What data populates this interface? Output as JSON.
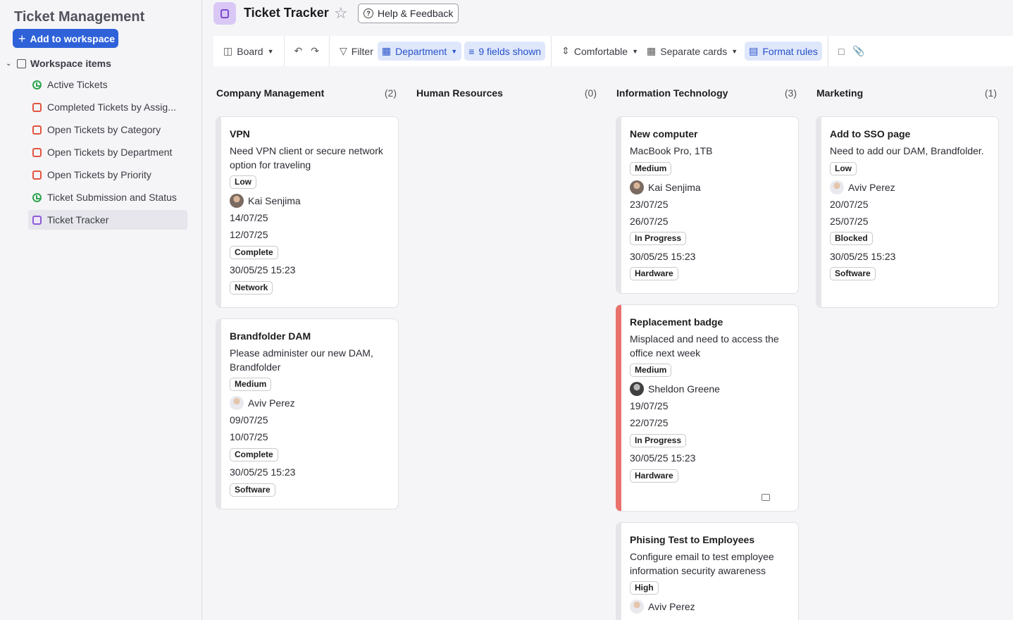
{
  "sidebar": {
    "title": "Ticket Management",
    "add_button": "Add to workspace",
    "section": "Workspace items",
    "items": [
      {
        "label": "Active Tickets",
        "icon": "dashboard-icon"
      },
      {
        "label": "Completed Tickets by Assig...",
        "icon": "report-icon"
      },
      {
        "label": "Open Tickets by Category",
        "icon": "report-icon"
      },
      {
        "label": "Open Tickets by Department",
        "icon": "report-icon"
      },
      {
        "label": "Open Tickets by Priority",
        "icon": "report-icon"
      },
      {
        "label": "Ticket Submission and Status",
        "icon": "dashboard-icon"
      },
      {
        "label": "Ticket Tracker",
        "icon": "board-icon"
      }
    ]
  },
  "header": {
    "title": "Ticket Tracker",
    "help": "Help & Feedback"
  },
  "toolbar": {
    "board": "Board",
    "filter": "Filter",
    "group": "Department",
    "fields": "9 fields shown",
    "density": "Comfortable",
    "cards": "Separate cards",
    "format": "Format rules"
  },
  "columns": [
    {
      "name": "Company Management",
      "count": "(2)",
      "cards": [
        {
          "title": "VPN",
          "desc": "Need VPN client or secure network option for traveling",
          "priority": "Low",
          "assignee": "Kai Senjima",
          "start": "14/07/25",
          "due": "12/07/25",
          "status": "Complete",
          "created": "30/05/25 15:23",
          "category": "Network"
        },
        {
          "title": "Brandfolder DAM",
          "desc": "Please administer our new DAM, Brandfolder",
          "priority": "Medium",
          "assignee": "Aviv Perez",
          "start": "09/07/25",
          "due": "10/07/25",
          "status": "Complete",
          "created": "30/05/25 15:23",
          "category": "Software"
        }
      ]
    },
    {
      "name": "Human Resources",
      "count": "(0)",
      "cards": []
    },
    {
      "name": "Information Technology",
      "count": "(3)",
      "cards": [
        {
          "title": "New computer",
          "desc": "MacBook Pro, 1TB",
          "priority": "Medium",
          "assignee": "Kai Senjima",
          "start": "23/07/25",
          "due": "26/07/25",
          "status": "In Progress",
          "created": "30/05/25 15:23",
          "category": "Hardware"
        },
        {
          "title": "Replacement badge",
          "desc": "Misplaced and need to access the office next week",
          "priority": "Medium",
          "assignee": "Sheldon Greene",
          "start": "19/07/25",
          "due": "22/07/25",
          "status": "In Progress",
          "created": "30/05/25 15:23",
          "category": "Hardware"
        },
        {
          "title": "Phising Test to Employees",
          "desc": "Configure email to test employee information security awareness",
          "priority": "High",
          "assignee": "Aviv Perez"
        }
      ]
    },
    {
      "name": "Marketing",
      "count": "(1)",
      "cards": [
        {
          "title": "Add to SSO page",
          "desc": "Need to add our DAM, Brandfolder.",
          "priority": "Low",
          "assignee": "Aviv Perez",
          "start": "20/07/25",
          "due": "25/07/25",
          "status": "Blocked",
          "created": "30/05/25 15:23",
          "category": "Software"
        }
      ]
    }
  ]
}
